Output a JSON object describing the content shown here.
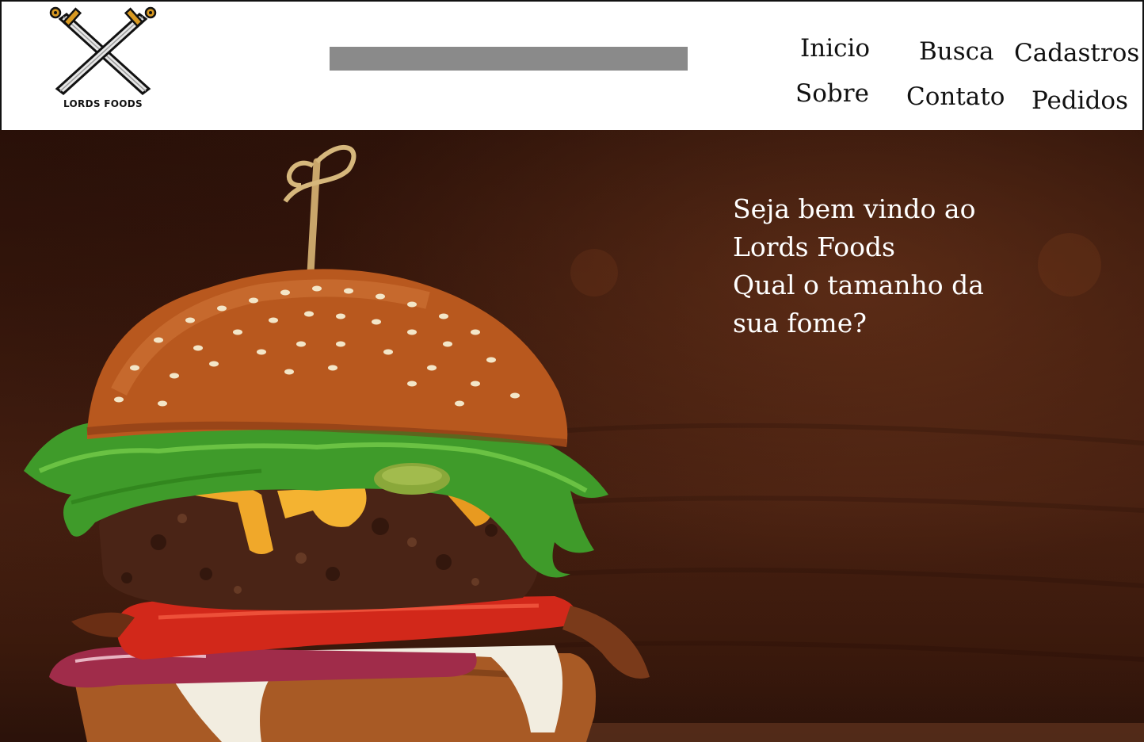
{
  "header": {
    "logo_text": "LORDS FOODS",
    "logo_icon": "crossed-swords-icon",
    "search": {
      "placeholder": "",
      "value": ""
    },
    "nav": {
      "inicio": "Inicio",
      "busca": "Busca",
      "cadastros": "Cadastros",
      "sobre": "Sobre",
      "contato": "Contato",
      "pedidos": "Pedidos"
    }
  },
  "hero": {
    "image": "burger-photo",
    "welcome_lines": [
      "Seja bem vindo ao",
      "Lords Foods",
      "Qual o tamanho da",
      "sua fome?"
    ]
  },
  "colors": {
    "header_bg": "#ffffff",
    "search_bar": "#8a8a8a",
    "hero_bg": "#3e1b0e",
    "hero_text": "#ffffff"
  }
}
